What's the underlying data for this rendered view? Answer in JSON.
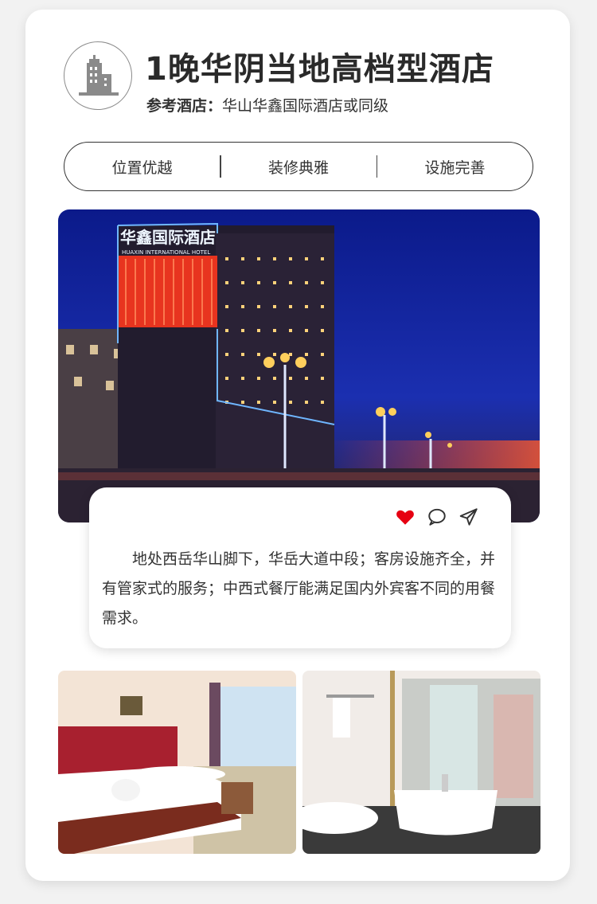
{
  "header": {
    "icon": "hotel-building-icon",
    "title": "1晚华阴当地高档型酒店",
    "reference_label": "参考酒店：",
    "reference_value": "华山华鑫国际酒店或同级"
  },
  "features": [
    "位置优越",
    "装修典雅",
    "设施完善"
  ],
  "main_photo": {
    "sign_cn": "华鑫国际酒店",
    "sign_en": "HUAXIN INTERNATIONAL HOTEL"
  },
  "description": {
    "text": "地处西岳华山脚下，华岳大道中段；客房设施齐全，并有管家式的服务；中西式餐厅能满足国内外宾客不同的用餐需求。",
    "actions": [
      "heart-icon",
      "comment-icon",
      "share-icon"
    ],
    "heart_color": "#e60012"
  },
  "photos": [
    "hotel-room-photo",
    "bathroom-photo"
  ]
}
